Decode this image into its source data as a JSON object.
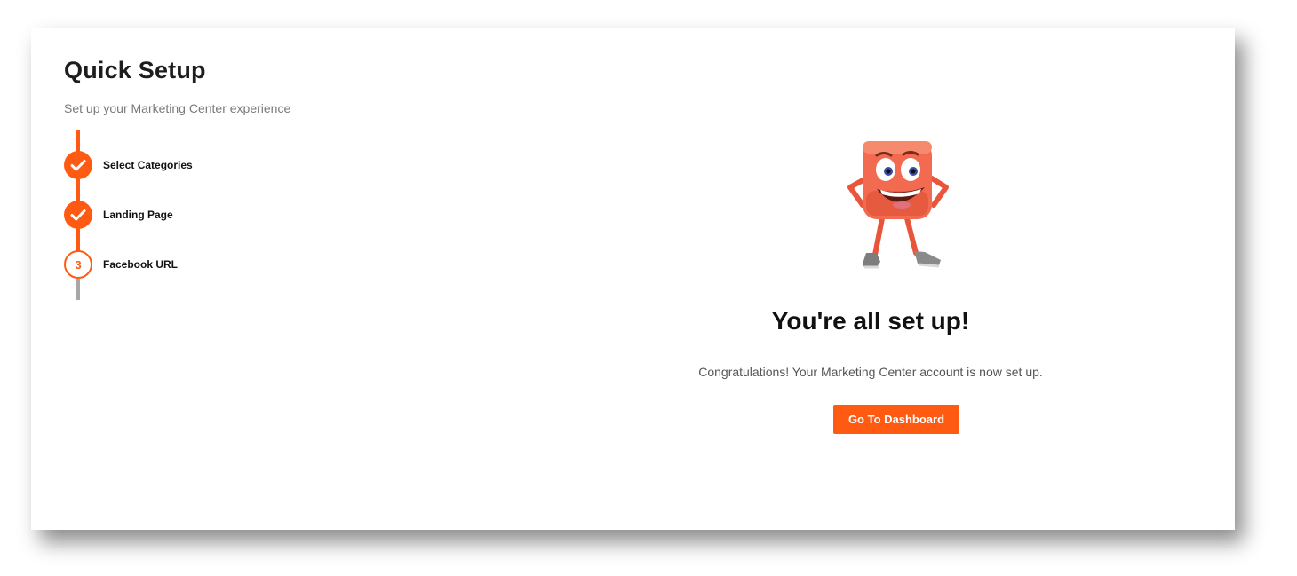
{
  "setup": {
    "title": "Quick Setup",
    "subtitle": "Set up your Marketing Center experience",
    "steps": [
      {
        "label": "Select Categories",
        "status": "complete",
        "icon": "check-icon"
      },
      {
        "label": "Landing Page",
        "status": "complete",
        "icon": "check-icon"
      },
      {
        "label": "Facebook URL",
        "status": "current",
        "number": "3"
      }
    ]
  },
  "completion": {
    "illustration": "cube-mascot-illustration",
    "headline": "You're all set up!",
    "message": "Congratulations! Your Marketing Center account is now set up.",
    "button_label": "Go To Dashboard"
  },
  "colors": {
    "accent": "#ff5a12",
    "rail_inactive": "#a7a7a7",
    "mascot": "#f26a50"
  }
}
